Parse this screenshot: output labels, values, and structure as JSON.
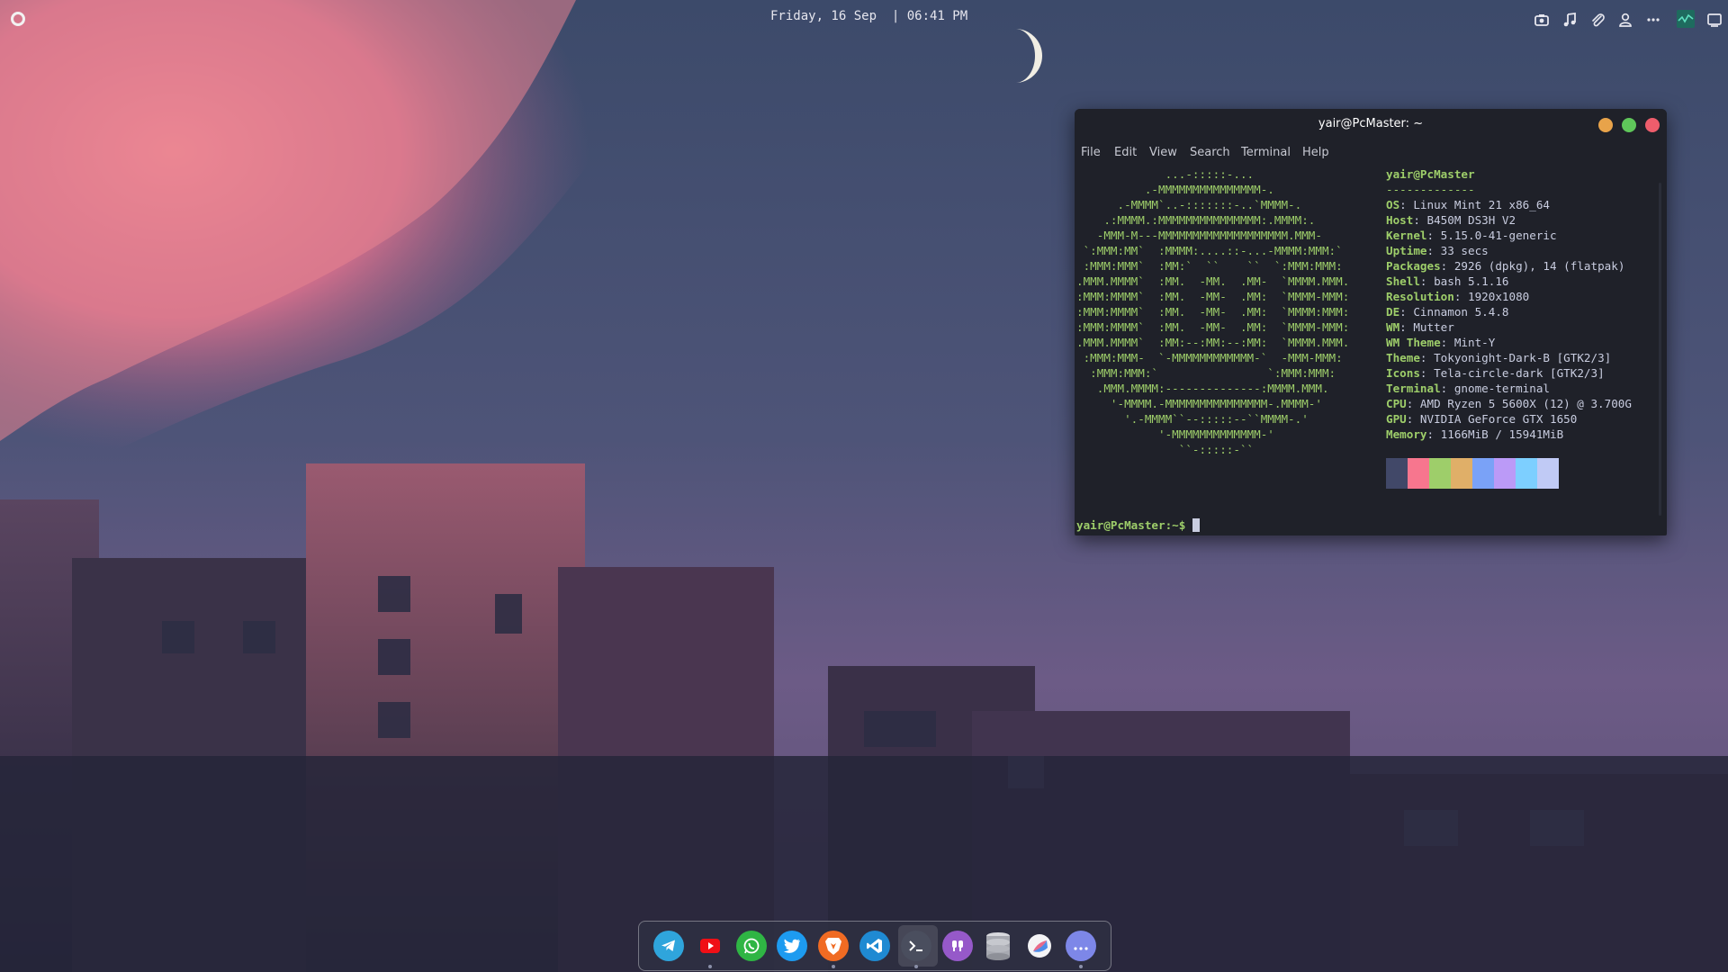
{
  "top_panel": {
    "clock": "Friday, 16 Sep  | 06:41 PM",
    "menu_icon": "circle-menu-icon",
    "tray_icons": [
      "screenshot-icon",
      "music-note-icon",
      "paperclip-icon",
      "user-icon",
      "more-icon",
      "system-monitor-icon",
      "workspace-icon"
    ]
  },
  "terminal": {
    "title": "yair@PcMaster: ~",
    "window_buttons": {
      "minimize_color": "#e8a34a",
      "maximize_color": "#5fc65a",
      "close_color": "#ee5d6c"
    },
    "menu": {
      "file": "File",
      "edit": "Edit",
      "view": "View",
      "search": "Search",
      "terminal": "Terminal",
      "help": "Help"
    },
    "user_host": "yair@PcMaster",
    "separator": "-------------",
    "info": [
      {
        "key": "OS",
        "value": "Linux Mint 21 x86_64"
      },
      {
        "key": "Host",
        "value": "B450M DS3H V2"
      },
      {
        "key": "Kernel",
        "value": "5.15.0-41-generic"
      },
      {
        "key": "Uptime",
        "value": "33 secs"
      },
      {
        "key": "Packages",
        "value": "2926 (dpkg), 14 (flatpak)"
      },
      {
        "key": "Shell",
        "value": "bash 5.1.16"
      },
      {
        "key": "Resolution",
        "value": "1920x1080"
      },
      {
        "key": "DE",
        "value": "Cinnamon 5.4.8"
      },
      {
        "key": "WM",
        "value": "Mutter"
      },
      {
        "key": "WM Theme",
        "value": "Mint-Y"
      },
      {
        "key": "Theme",
        "value": "Tokyonight-Dark-B [GTK2/3]"
      },
      {
        "key": "Icons",
        "value": "Tela-circle-dark [GTK2/3]"
      },
      {
        "key": "Terminal",
        "value": "gnome-terminal"
      },
      {
        "key": "CPU",
        "value": "AMD Ryzen 5 5600X (12) @ 3.700G"
      },
      {
        "key": "GPU",
        "value": "NVIDIA GeForce GTX 1650"
      },
      {
        "key": "Memory",
        "value": "1166MiB / 15941MiB"
      }
    ],
    "palette": [
      "#414868",
      "#f7768e",
      "#9ece6a",
      "#e0af68",
      "#7aa2f7",
      "#bb9af7",
      "#7dcfff",
      "#c0caf5"
    ],
    "prompt": "yair@PcMaster:~$",
    "ascii_logo": [
      "             ...-:::::-...",
      "          .-MMMMMMMMMMMMMMM-.",
      "      .-MMMM`..-:::::::-..`MMMM-.",
      "    .:MMMM.:MMMMMMMMMMMMMMM:.MMMM:.",
      "   -MMM-M---MMMMMMMMMMMMMMMMMMM.MMM-",
      " `:MMM:MM`  :MMMM:....::-...-MMMM:MMM:`",
      " :MMM:MMM`  :MM:`  ``    ``  `:MMM:MMM:",
      ".MMM.MMMM`  :MM.  -MM.  .MM-  `MMMM.MMM.",
      ":MMM:MMMM`  :MM.  -MM-  .MM:  `MMMM-MMM:",
      ":MMM:MMMM`  :MM.  -MM-  .MM:  `MMMM:MMM:",
      ":MMM:MMMM`  :MM.  -MM-  .MM:  `MMMM-MMM:",
      ".MMM.MMMM`  :MM:--:MM:--:MM:  `MMMM.MMM.",
      " :MMM:MMM-  `-MMMMMMMMMMMM-`  -MMM-MMM:",
      "  :MMM:MMM:`                `:MMM:MMM:",
      "   .MMM.MMMM:--------------:MMMM.MMM.",
      "     '-MMMM.-MMMMMMMMMMMMMMM-.MMMM-'",
      "       '.-MMMM``--:::::--``MMMM-.'",
      "            '-MMMMMMMMMMMMM-'",
      "               ``-:::::-``"
    ]
  },
  "dock": {
    "apps": [
      {
        "name": "telegram",
        "color": "#2fa5dc"
      },
      {
        "name": "youtube",
        "color": "#f00f16"
      },
      {
        "name": "whatsapp",
        "color": "#2fb544"
      },
      {
        "name": "twitter",
        "color": "#1d9bf0"
      },
      {
        "name": "brave",
        "color": "#f06b23"
      },
      {
        "name": "vscode",
        "color": "#1f8ad2"
      },
      {
        "name": "terminal",
        "color": "#4a4e5e"
      },
      {
        "name": "podcasts",
        "color": "#9659c9"
      },
      {
        "name": "database",
        "color": "#9ea0a8"
      },
      {
        "name": "color-picker",
        "color": "#e8e8ec"
      },
      {
        "name": "chat",
        "color": "#7d87e8"
      }
    ]
  }
}
